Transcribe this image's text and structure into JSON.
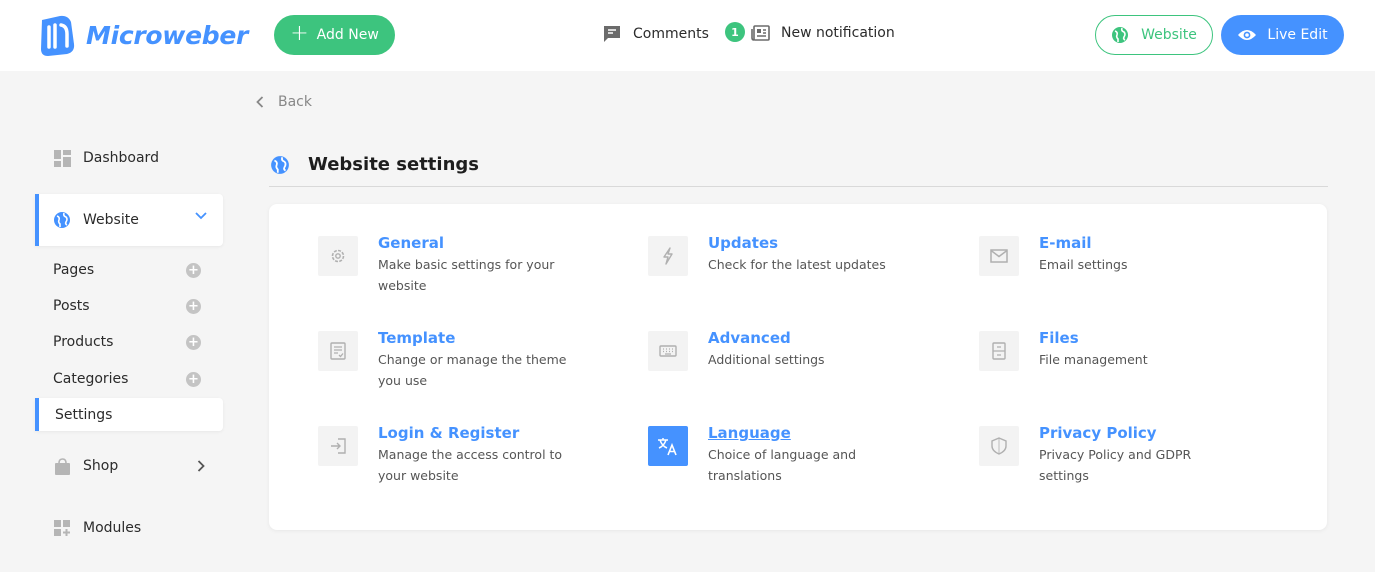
{
  "header": {
    "logo_text": "Microweber",
    "add_new_label": "Add New",
    "comments_label": "Comments",
    "notification_count": "1",
    "notification_label": "New notification",
    "website_button_label": "Website",
    "live_edit_label": "Live Edit"
  },
  "colors": {
    "primary": "#4592ff",
    "success": "#3dc47e",
    "background": "#f5f5f5"
  },
  "sidebar": {
    "dashboard": "Dashboard",
    "website": "Website",
    "sub_items": [
      {
        "label": "Pages"
      },
      {
        "label": "Posts"
      },
      {
        "label": "Products"
      },
      {
        "label": "Categories"
      }
    ],
    "settings": "Settings",
    "shop": "Shop",
    "modules": "Modules"
  },
  "main": {
    "back_label": "Back",
    "page_title": "Website settings",
    "settings": [
      {
        "title": "General",
        "desc": "Make basic settings for your website",
        "icon": "gear-icon"
      },
      {
        "title": "Updates",
        "desc": "Check for the latest updates",
        "icon": "flash-icon"
      },
      {
        "title": "E-mail",
        "desc": "Email settings",
        "icon": "mail-icon"
      },
      {
        "title": "Template",
        "desc": "Change or manage the theme you use",
        "icon": "template-icon"
      },
      {
        "title": "Advanced",
        "desc": "Additional settings",
        "icon": "keyboard-icon"
      },
      {
        "title": "Files",
        "desc": "File management",
        "icon": "file-cabinet-icon"
      },
      {
        "title": "Login & Register",
        "desc": "Manage the access control to your website",
        "icon": "login-icon"
      },
      {
        "title": "Language",
        "desc": "Choice of language and translations",
        "icon": "translate-icon"
      },
      {
        "title": "Privacy Policy",
        "desc": "Privacy Policy and GDPR settings",
        "icon": "shield-icon"
      }
    ]
  }
}
